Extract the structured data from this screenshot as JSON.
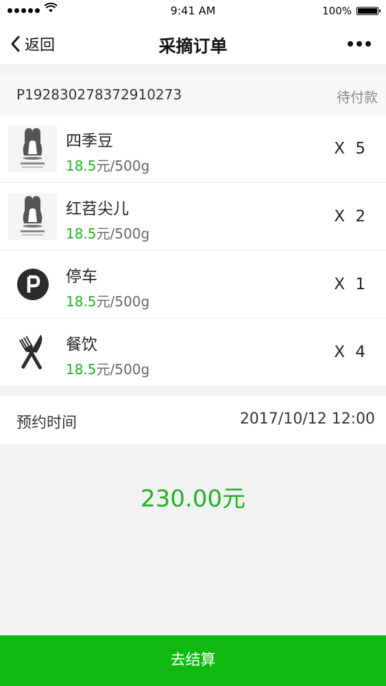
{
  "status_bar": {
    "time": "9:41 AM",
    "battery": "100%"
  },
  "nav": {
    "back_label": "返回",
    "title": "采摘订单",
    "more_icon": "ellipsis-icon"
  },
  "order": {
    "number": "P192830278372910273",
    "status": "待付款"
  },
  "items": [
    {
      "name": "四季豆",
      "price": "18.5",
      "unit": "元/500g",
      "qty": "X 5",
      "icon": "brand-logo-icon"
    },
    {
      "name": "红苕尖儿",
      "price": "18.5",
      "unit": "元/500g",
      "qty": "X 2",
      "icon": "brand-logo-icon"
    },
    {
      "name": "停车",
      "price": "18.5",
      "unit": "元/500g",
      "qty": "X 1",
      "icon": "parking-icon"
    },
    {
      "name": "餐饮",
      "price": "18.5",
      "unit": "元/500g",
      "qty": "X 4",
      "icon": "fork-knife-icon"
    }
  ],
  "reservation": {
    "label": "预约时间",
    "value": "2017/10/12 12:00"
  },
  "total": "230.00元",
  "checkout_label": "去结算",
  "colors": {
    "accent": "#1fb11f",
    "button": "#10b910"
  }
}
